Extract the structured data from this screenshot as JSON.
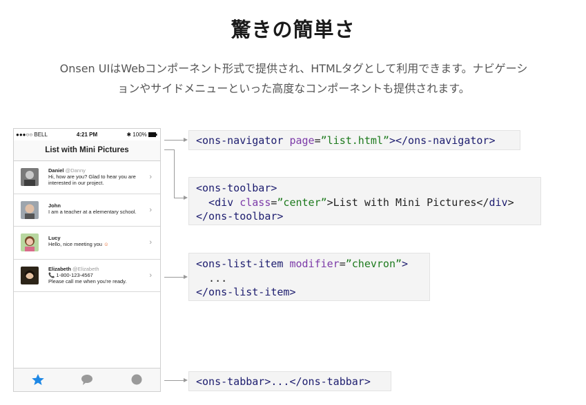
{
  "header": {
    "title": "驚きの簡単さ",
    "lead_line1": "Onsen UIはWebコンポーネント形式で提供され、HTMLタグとして利用できます。ナビゲーシ",
    "lead_line2": "ョンやサイドメニューといった高度なコンポーネントも提供されます。"
  },
  "phone": {
    "status": {
      "carrier": "●●●○○ BELL",
      "wifi_icon": "wifi-icon",
      "time": "4:21 PM",
      "battery": "100%",
      "bluetooth_icon": "bluetooth-icon"
    },
    "navbar_title": "List with Mini Pictures",
    "items": [
      {
        "name": "Daniel",
        "handle": "@Danny",
        "line1": "Hi, how are you? Glad to hear you are",
        "line2": "interested in our project."
      },
      {
        "name": "John",
        "handle": "",
        "line1": "I am a teacher at a elementary school.",
        "line2": ""
      },
      {
        "name": "Lucy",
        "handle": "",
        "line1": "Hello, nice meeting you",
        "line2": ""
      },
      {
        "name": "Elizabeth",
        "handle": "@Elizabeth",
        "line1": "📞 1-800-123-4567",
        "line2": "Please call me when you're ready."
      }
    ],
    "chevron": "›",
    "tabs": [
      "star-icon",
      "chat-bubble-icon",
      "circle-icon"
    ],
    "accent": "#1e88e5"
  },
  "code": {
    "navigator": {
      "open": "<ons-navigator",
      "attr": "page",
      "eq": "=",
      "val": "”list.html”",
      "close": "></ons-navigator>"
    },
    "toolbar": {
      "l1": "<ons-toolbar>",
      "l2_open": "  <div",
      "l2_attr": "class",
      "l2_eq": "=",
      "l2_val": "”center”",
      "l2_text": ">List with Mini Pictures</",
      "l2_tag": "div",
      "l2_end": ">",
      "l3": "</ons-toolbar>"
    },
    "list_item": {
      "open": "<ons-list-item",
      "attr": "modifier",
      "eq": "=",
      "val": "”chevron”",
      "end": ">",
      "l2": "  ...",
      "l3": "</ons-list-item>"
    },
    "tabbar": {
      "text": "<ons-tabbar>...</ons-tabbar>"
    }
  }
}
